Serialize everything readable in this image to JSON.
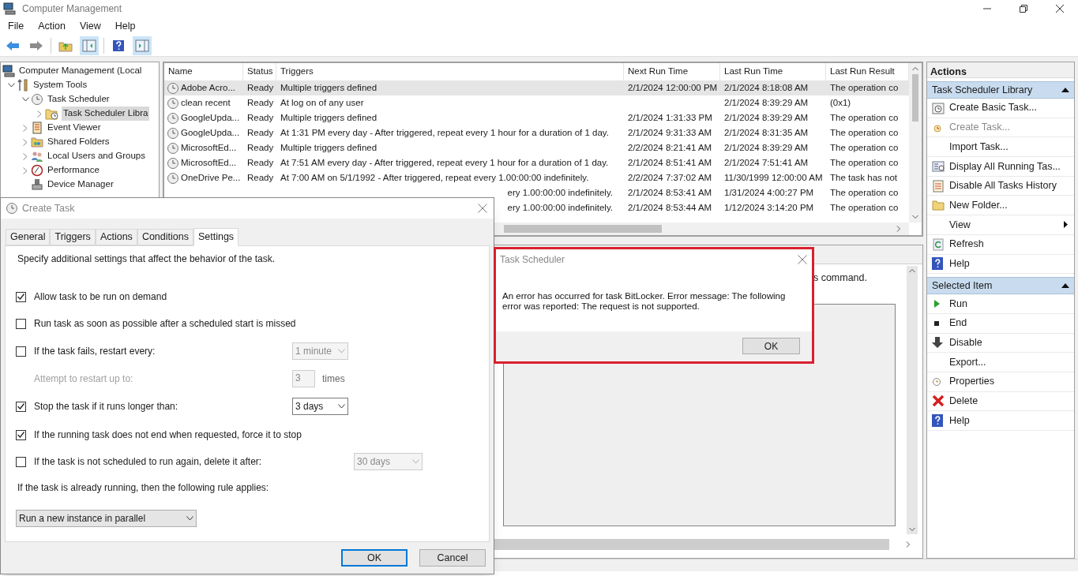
{
  "window": {
    "title": "Computer Management"
  },
  "menu": [
    "File",
    "Action",
    "View",
    "Help"
  ],
  "tree": [
    {
      "label": "Computer Management (Local",
      "selected": false,
      "children": [
        {
          "label": "System Tools",
          "selected": false,
          "expanded": true,
          "children": [
            {
              "label": "Task Scheduler",
              "selected": false,
              "expanded": true,
              "children": [
                {
                  "label": "Task Scheduler Libra",
                  "selected": true,
                  "expanded": false
                }
              ]
            },
            {
              "label": "Event Viewer",
              "selected": false,
              "expanded": false
            },
            {
              "label": "Shared Folders",
              "selected": false,
              "expanded": false
            },
            {
              "label": "Local Users and Groups",
              "selected": false,
              "expanded": false
            },
            {
              "label": "Performance",
              "selected": false,
              "expanded": false
            },
            {
              "label": "Device Manager",
              "selected": false
            }
          ]
        }
      ]
    }
  ],
  "table": {
    "columns": [
      "Name",
      "Status",
      "Triggers",
      "Next Run Time",
      "Last Run Time",
      "Last Run Result"
    ],
    "rows": [
      {
        "name": "Adobe Acro...",
        "status": "Ready",
        "triggers": "Multiple triggers defined",
        "next_run": "2/1/2024 12:00:00 PM",
        "last_run": "2/1/2024 8:18:08 AM",
        "result": "The operation co",
        "selected": true
      },
      {
        "name": "clean recent",
        "status": "Ready",
        "triggers": "At log on of any user",
        "last_run": "2/1/2024 8:39:29 AM",
        "result": "(0x1)",
        "selected": false
      },
      {
        "name": "GoogleUpda...",
        "status": "Ready",
        "triggers": "Multiple triggers defined",
        "next_run": "2/1/2024 1:31:33 PM",
        "last_run": "2/1/2024 8:39:29 AM",
        "result": "The operation co",
        "selected": false
      },
      {
        "name": "GoogleUpda...",
        "status": "Ready",
        "triggers": "At 1:31 PM every day - After triggered, repeat every 1 hour for a duration of 1 day.",
        "next_run": "2/1/2024 9:31:33 AM",
        "last_run": "2/1/2024 8:31:35 AM",
        "result": "The operation co",
        "selected": false
      },
      {
        "name": "MicrosoftEd...",
        "status": "Ready",
        "triggers": "Multiple triggers defined",
        "next_run": "2/2/2024 8:21:41 AM",
        "last_run": "2/1/2024 8:39:29 AM",
        "result": "The operation co",
        "selected": false
      },
      {
        "name": "MicrosoftEd...",
        "status": "Ready",
        "triggers": "At 7:51 AM every day - After triggered, repeat every 1 hour for a duration of 1 day.",
        "next_run": "2/1/2024 8:51:41 AM",
        "last_run": "2/1/2024 7:51:41 AM",
        "result": "The operation co",
        "selected": false
      },
      {
        "name": "OneDrive Pe...",
        "status": "Ready",
        "triggers": "At 7:00 AM on 5/1/1992 - After triggered, repeat every 1.00:00:00 indefinitely.",
        "next_run": "2/2/2024 7:37:02 AM",
        "last_run": "11/30/1999 12:00:00 AM",
        "result": "The task has not",
        "selected": false
      },
      {
        "triggers": "ery 1.00:00:00 indefinitely.",
        "next_run": "2/1/2024 8:53:41 AM",
        "last_run": "1/31/2024 4:00:27 PM",
        "result": "The operation co",
        "selected": false
      },
      {
        "triggers": "ery 1.00:00:00 indefinitely.",
        "next_run": "2/1/2024 8:53:44 AM",
        "last_run": "1/12/2024 3:14:20 PM",
        "result": "The operation co",
        "selected": false
      }
    ]
  },
  "lower_pane": {
    "text": "s command."
  },
  "actions": {
    "title": "Actions",
    "sections": [
      {
        "title": "Task Scheduler Library",
        "items": [
          {
            "label": "Create Basic Task...",
            "disabled": false
          },
          {
            "label": "Create Task...",
            "disabled": true
          },
          {
            "label": "Import Task...",
            "disabled": false
          },
          {
            "label": "Display All Running Tas...",
            "disabled": false
          },
          {
            "label": "Disable All Tasks History",
            "disabled": false
          },
          {
            "label": "New Folder...",
            "disabled": false
          },
          {
            "label": "View",
            "disabled": false,
            "submenu": true
          },
          {
            "label": "Refresh",
            "disabled": false
          },
          {
            "label": "Help",
            "disabled": false
          }
        ]
      },
      {
        "title": "Selected Item",
        "items": [
          {
            "label": "Run",
            "disabled": false
          },
          {
            "label": "End",
            "disabled": false
          },
          {
            "label": "Disable",
            "disabled": false
          },
          {
            "label": "Export...",
            "disabled": false
          },
          {
            "label": "Properties",
            "disabled": false
          },
          {
            "label": "Delete",
            "disabled": false
          },
          {
            "label": "Help",
            "disabled": false
          }
        ]
      }
    ]
  },
  "create_task": {
    "title": "Create Task",
    "tabs": [
      {
        "label": "General",
        "selected": false
      },
      {
        "label": "Triggers",
        "selected": false
      },
      {
        "label": "Actions",
        "selected": false
      },
      {
        "label": "Conditions",
        "selected": false
      },
      {
        "label": "Settings",
        "selected": true
      }
    ],
    "description": "Specify additional settings that affect the behavior of the task.",
    "options": [
      {
        "kind": "checkbox",
        "label": "Allow task to be run on demand",
        "checked": true
      },
      {
        "kind": "checkbox",
        "label": "Run task as soon as possible after a scheduled start is missed",
        "checked": false
      },
      {
        "kind": "checkbox",
        "label": "If the task fails, restart every:",
        "checked": false,
        "dropdown": {
          "value": "1 minute",
          "disabled": true
        }
      },
      {
        "kind": "spin",
        "label": "Attempt to restart up to:",
        "disabled": true,
        "value": "3",
        "suffix": "times"
      },
      {
        "kind": "checkbox",
        "label": "Stop the task if it runs longer than:",
        "checked": true,
        "dropdown": {
          "value": "3 days",
          "disabled": false
        }
      },
      {
        "kind": "checkbox",
        "label": "If the running task does not end when requested, force it to stop",
        "checked": true
      },
      {
        "kind": "checkbox",
        "label": "If the task is not scheduled to run again, delete it after:",
        "checked": false,
        "dropdown": {
          "value": "30 days",
          "disabled": true,
          "wide": true
        }
      },
      {
        "kind": "text",
        "label": "If the task is already running, then the following rule applies:"
      },
      {
        "kind": "select",
        "value": "Run a new instance in parallel"
      }
    ],
    "buttons": [
      {
        "label": "OK",
        "default": true
      },
      {
        "label": "Cancel",
        "default": false
      }
    ]
  },
  "error_dialog": {
    "title": "Task Scheduler",
    "message": "An error has occurred for task BitLocker. Error message: The following error was reported: The request is not supported.",
    "button": "OK"
  }
}
